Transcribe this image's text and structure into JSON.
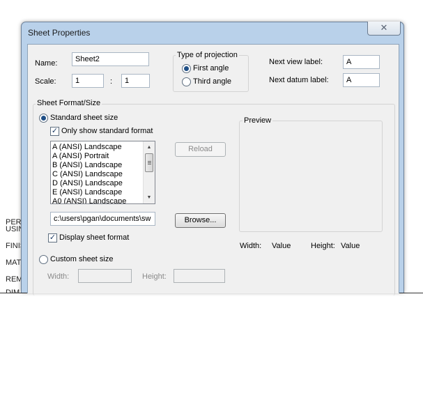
{
  "background_texts": [
    "PERI",
    "USIN",
    "FINIS",
    "MAT",
    "REM",
    "DIM"
  ],
  "dialog": {
    "title": "Sheet Properties",
    "close_glyph": "✕",
    "name_label": "Name:",
    "name_value": "Sheet2",
    "scale_label": "Scale:",
    "scale_left": "1",
    "scale_sep": ":",
    "scale_right": "1",
    "projection": {
      "legend": "Type of projection",
      "first_angle": "First angle",
      "third_angle": "Third angle",
      "selected": "first_angle"
    },
    "next_view_label": "Next view label:",
    "next_view_value": "A",
    "next_datum_label": "Next datum label:",
    "next_datum_value": "A",
    "sheet_format": {
      "legend": "Sheet Format/Size",
      "standard_label": "Standard sheet size",
      "only_standard_label": "Only show standard format",
      "only_standard_checked": true,
      "formats": [
        "A (ANSI) Landscape",
        "A (ANSI) Portrait",
        "B (ANSI) Landscape",
        "C (ANSI) Landscape",
        "D (ANSI) Landscape",
        "E (ANSI) Landscape",
        "A0 (ANSI) Landscape"
      ],
      "reload_label": "Reload",
      "path_value": "c:\\users\\pgan\\documents\\sw",
      "browse_label": "Browse...",
      "display_format_label": "Display sheet format",
      "display_format_checked": true,
      "custom_label": "Custom sheet size",
      "width_label": "Width:",
      "height_label": "Height:"
    },
    "preview": {
      "legend": "Preview",
      "width_label": "Width:",
      "width_value": "Value",
      "height_label": "Height:",
      "height_value": "Value"
    }
  }
}
